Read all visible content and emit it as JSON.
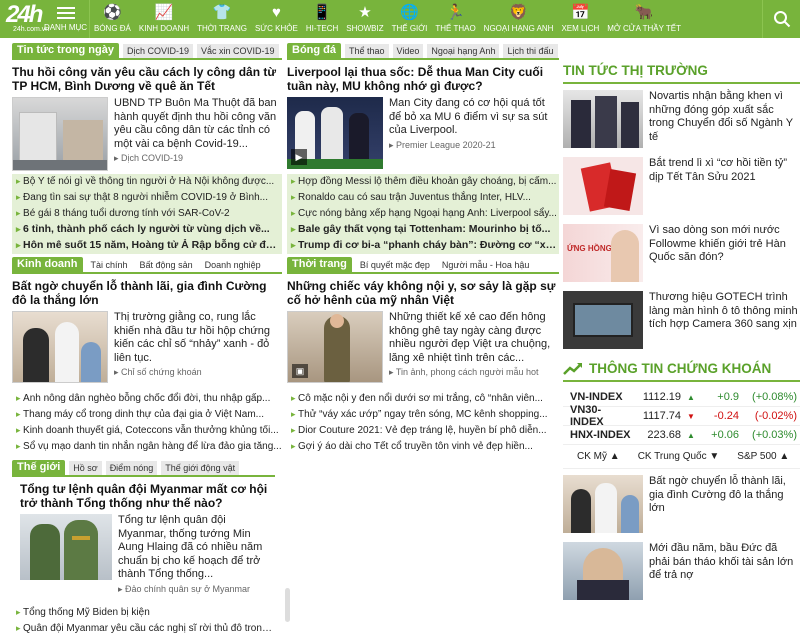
{
  "logo": {
    "num": "24h",
    "sub": "24h.com.vn"
  },
  "menu_label": "DANH MỤC",
  "nav": [
    {
      "label": "BÓNG ĐÁ",
      "icon": "⚽"
    },
    {
      "label": "KINH DOANH",
      "icon": "📈"
    },
    {
      "label": "THỜI TRANG",
      "icon": "👕"
    },
    {
      "label": "SỨC KHỎE",
      "icon": "♥"
    },
    {
      "label": "HI-TECH",
      "icon": "📱"
    },
    {
      "label": "SHOWBIZ",
      "icon": "★"
    },
    {
      "label": "THẾ GIỚI",
      "icon": "🌐"
    },
    {
      "label": "THỂ THAO",
      "icon": "🏃"
    },
    {
      "label": "NGOẠI HẠNG ANH",
      "icon": "🦁"
    },
    {
      "label": "XEM LỊCH",
      "icon": "📅"
    },
    {
      "label": "MỞ CỬA THẦY TẾT",
      "icon": "🐂"
    }
  ],
  "news": {
    "tabs": [
      "Tin tức trong ngày",
      "Dịch COVID-19",
      "Vắc xin COVID-19"
    ],
    "headline": "Thu hồi công văn yêu cầu cách ly công dân từ TP HCM, Bình Dương về quê ăn Tết",
    "summary": "UBND TP Buôn Ma Thuột đã ban hành quyết định thu hồi công văn yêu cầu công dân từ các tỉnh có một vài ca bệnh Covid-19...",
    "category": "Dịch COVID-19",
    "list": [
      "Bộ Y tế nói gì về thông tin người ở Hà Nội không được...",
      "Đang tìn sai sự thật 8 người nhiễm COVID-19 ở Bình...",
      "Bé gái 8 tháng tuổi dương tính với SAR-CoV-2",
      "6 tỉnh, thành phố cách ly người từ vùng dịch về...",
      "Hôn mê suốt 15 năm, Hoàng tử Ả Rập bỗng cử động..."
    ]
  },
  "football": {
    "tabs": [
      "Bóng đá",
      "Thể thao",
      "Video",
      "Ngoại hạng Anh",
      "Lịch thi đấu"
    ],
    "headline": "Liverpool lại thua sốc: Dễ thua Man City cuối tuần này, MU không nhớ gì được?",
    "summary": "Man City đang có cơ hội quá tốt để bỏ xa MU 6 điểm vì sự sa sút của Liverpool.",
    "category": "Premier League 2020-21",
    "list": [
      "Hợp đồng Messi lộ thêm điều khoản gây choáng, bị cấm...",
      "Ronaldo cau có sau trận Juventus thắng Inter, HLV...",
      "Cực nóng bảng xếp hạng Ngoại hạng Anh: Liverpool sẩy...",
      "Bale gây thất vọng tại Tottenham: Mourinho bị tố...",
      "Trump đi cơ bi-a “phanh cháy bàn”: Đường cơ “xuất..."
    ]
  },
  "business": {
    "tabs": [
      "Kinh doanh",
      "Tài chính",
      "Bất động sản",
      "Doanh nghiệp"
    ],
    "headline": "Bất ngờ chuyển lỗ thành lãi, gia đình Cường đô la thắng lớn",
    "summary": "Thị trường giằng co, rung lắc khiến nhà đầu tư hồi hộp chứng kiến các chỉ số “nhảy” xanh - đỏ liên tục.",
    "category": "Chỉ số chứng khoán",
    "list": [
      "Anh nông dân nghèo bỗng chốc đổi đời, thu nhập gấp...",
      "Thang máy cổ trong dinh thự của đại gia ở Việt Nam...",
      "Kinh doanh thuyết giá, Coteccons vẫn thưởng khủng tối...",
      "Sổ vụ mạo danh tin nhắn ngân hàng để lừa đảo gia tăng..."
    ]
  },
  "fashion": {
    "tabs": [
      "Thời trang",
      "Bí quyết mặc đẹp",
      "Người mẫu - Hoa hậu"
    ],
    "headline": "Những chiếc váy không nội y, sơ sảy là gặp sự cố hở hênh của mỹ nhân Việt",
    "summary": "Những thiết kế xẻ cao đến hông không ghê tay ngày càng được nhiều người đẹp Việt ưa chuộng, lăng xê nhiệt tình trên các...",
    "category": "Tin ảnh, phong cách người mẫu hot",
    "list": [
      "Cô mặc nội y đen nổi dưới sơ mi trắng, cô “nhân viên...",
      "Thử “váy xác ướp” ngay trên sóng, MC kênh shopping...",
      "Dior Couture 2021: Vẻ đẹp tráng lệ, huyền bí phô diễn...",
      "Gợi ý áo dài cho Tết cổ truyền tôn vinh vẻ đẹp hiền..."
    ]
  },
  "world": {
    "tabs": [
      "Thế giới",
      "Hồ sơ",
      "Điểm nóng",
      "Thế giới động vật"
    ],
    "headline": "Tổng tư lệnh quân đội Myanmar mất cơ hội trở thành Tổng thống như thế nào?",
    "summary": "Tổng tư lệnh quân đội Myanmar, thống tướng Min Aung Hlaing đã có nhiều năm chuẩn bị cho kế hoạch để trở thành Tổng thống...",
    "category": "Đảo chính quân sự ở Myanmar",
    "list": [
      "Tổng thống Mỹ Biden bị kiện",
      "Quân đội Myanmar yêu cầu các nghị sĩ rời thủ đô trong..."
    ]
  },
  "market": {
    "title": "TIN TỨC THỊ TRƯỜNG",
    "items": [
      "Novartis nhận bằng khen vì những đóng góp xuất sắc trong Chuyển đổi số Ngành Y tế",
      "Bắt trend lì xì “cơ hồi tiền tỷ” dịp Tết Tân Sửu 2021",
      "Vì sao dòng son mới nước Followme khiến giới trẻ Hàn Quốc săn đón?",
      "Thương hiệu GOTECH trình làng màn hình ô tô thông minh tích hợp Camera 360 sang xịn"
    ],
    "thumb_text_3": "ỨNG HỒNG"
  },
  "stocks": {
    "title": "THÔNG TIN CHỨNG KHOÁN",
    "rows": [
      {
        "name": "VN-INDEX",
        "value": "1112.19",
        "arrow": "▲",
        "change": "+0.9",
        "pct": "(+0.08%)",
        "dir": "up"
      },
      {
        "name": "VN30-INDEX",
        "value": "1117.74",
        "arrow": "▼",
        "change": "-0.24",
        "pct": "(-0.02%)",
        "dir": "down"
      },
      {
        "name": "HNX-INDEX",
        "value": "223.68",
        "arrow": "▲",
        "change": "+0.06",
        "pct": "(+0.03%)",
        "dir": "up"
      }
    ],
    "tabs": [
      "CK Mỹ ▲",
      "CK Trung Quốc ▼",
      "S&P 500 ▲"
    ],
    "items": [
      "Bất ngờ chuyển lỗ thành lãi, gia đình Cường đô la thắng lớn",
      "Mới đầu năm, bầu Đức đã phải bán tháo khối tài sản lớn để trả nợ"
    ]
  }
}
